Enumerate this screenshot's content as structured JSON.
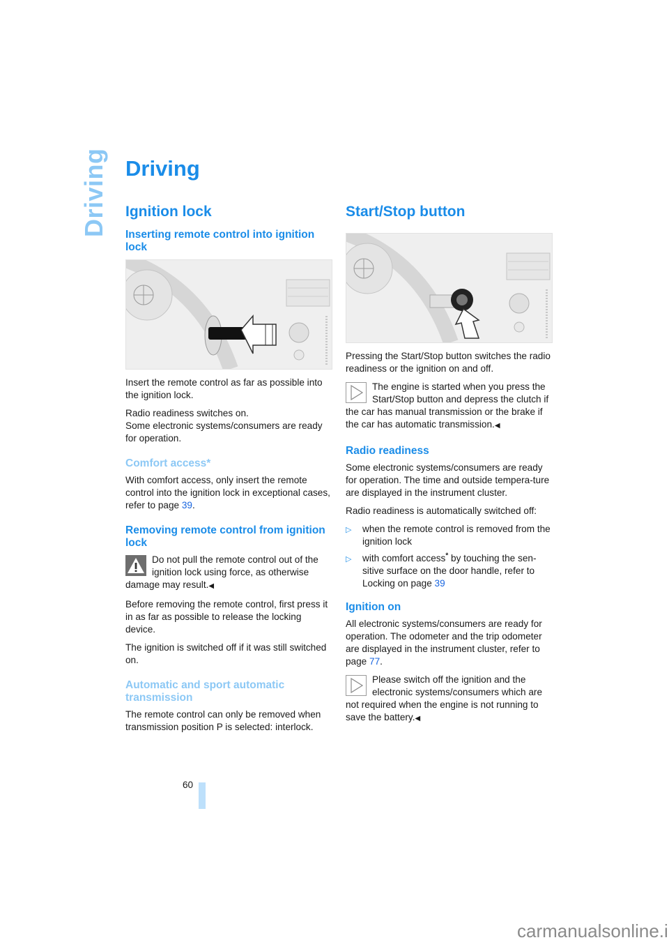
{
  "side_tab": "Driving",
  "page_title": "Driving",
  "left_column": {
    "section_title": "Ignition lock",
    "subsection1_title": "Inserting remote control into ignition lock",
    "figure1_label": "Remote control inserted into ignition lock with arrow",
    "p1": "Insert the remote control as far as possible into the ignition lock.",
    "p2a": "Radio readiness switches on.",
    "p2b": "Some electronic systems/consumers are ready for operation.",
    "subsection2_title": "Comfort access*",
    "p3_prefix": "With comfort access, only insert the remote control into the ignition lock in exceptional cases, refer to page ",
    "p3_link": "39",
    "p3_suffix": ".",
    "subsection3_title": "Removing remote control from ignition lock",
    "warning_text": "Do not pull the remote control out of the ignition lock using force, as otherwise damage may result.",
    "end_mark": "◀",
    "p4": "Before removing the remote control, first press it in as far as possible to release the locking device.",
    "p5": "The ignition is switched off if it was still switched on.",
    "subsection4_title": "Automatic and sport automatic transmission",
    "p6": "The remote control can only be removed when transmission position P is selected: interlock."
  },
  "right_column": {
    "section_title": "Start/Stop button",
    "figure2_label": "Start/Stop button with arrow",
    "p1": "Pressing the Start/Stop button switches the radio readiness or the ignition on and off.",
    "note1_text": "The engine is started when you press the Start/Stop button and depress the clutch if the car has manual transmission or the brake if the car has automatic transmission.",
    "end_mark": "◀",
    "subsection1_title": "Radio readiness",
    "p2": "Some electronic systems/consumers are ready for operation. The time and outside tempera-ture are displayed in the instrument cluster.",
    "p3": "Radio readiness is automatically switched off:",
    "bullet_marker": "▷",
    "bullet1": "when the remote control is removed from the ignition lock",
    "bullet2_prefix": "with comfort access",
    "bullet2_star": "*",
    "bullet2_mid": " by touching the sen-sitive surface on the door handle, refer to Locking on page ",
    "bullet2_link": "39",
    "subsection2_title": "Ignition on",
    "p4_prefix": "All electronic systems/consumers are ready for operation. The odometer and the trip odometer are displayed in the instrument cluster, refer to page ",
    "p4_link": "77",
    "p4_suffix": ".",
    "note2_text": "Please switch off the ignition and the electronic systems/consumers which are not required when the engine is not running to save the battery."
  },
  "footer": {
    "page_number": "60",
    "watermark": "carmanualsonline.info"
  }
}
